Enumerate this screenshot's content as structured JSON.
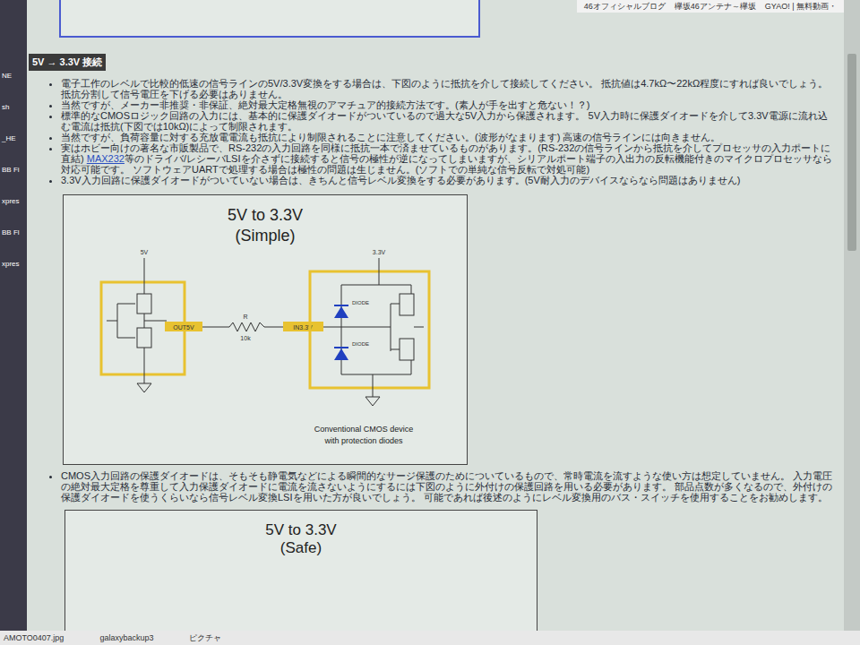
{
  "browser_tabs": [
    "46オフィシャルブログ",
    "欅坂46アンテナ～欅坂",
    "GYAO! | 無料動画・"
  ],
  "desktop_icons": [
    "NE",
    "sh",
    "_HE",
    "BB Fi",
    "xpres",
    "BB Fl",
    "xpres"
  ],
  "section_heading": "5V → 3.3V 接続",
  "bullets": [
    [
      {
        "text": "電子工作のレベルで比較的低速の信号ラインの5V/3.3V変換をする場合は、下図のように抵抗を介して接続してください。 抵抗値は4.7kΩ〜22kΩ程度にすれば良いでしょう。 抵抗分割して信号電圧を下げる必要はありません。",
        "link": false
      }
    ],
    [
      {
        "text": "当然ですが、メーカー非推奨・非保証、絶対最大定格無視のアマチュア的接続方法です。(素人が手を出すと危ない！？)",
        "link": false
      }
    ],
    [
      {
        "text": "標準的なCMOSロジック回路の入力には、基本的に保護ダイオードがついているので過大な5V入力から保護されます。 5V入力時に保護ダイオードを介して3.3V電源に流れ込む電流は抵抗(下図では10kΩ)によって制限されます。",
        "link": false
      }
    ],
    [
      {
        "text": "当然ですが、負荷容量に対する充放電電流も抵抗により制限されることに注意してください。(波形がなまります) 高速の信号ラインには向きません。",
        "link": false
      }
    ],
    [
      {
        "text": "実はホビー向けの著名な市販製品で、RS-232の入力回路を同様に抵抗一本で済ませているものがあります。(RS-232の信号ラインから抵抗を介してプロセッサの入力ポートに直結) ",
        "link": false
      },
      {
        "text": "MAX232",
        "link": true
      },
      {
        "text": "等のドライバ/レシーバLSIを介さずに接続すると信号の極性が逆になってしまいますが、シリアルポート端子の入出力の反転機能付きのマイクロプロセッサなら対応可能です。 ソフトウェアUARTで処理する場合は極性の問題は生じません。(ソフトでの単純な信号反転で対処可能)",
        "link": false
      }
    ],
    [
      {
        "text": "3.3V入力回路に保護ダイオードがついていない場合は、きちんと信号レベル変換をする必要があります。(5V耐入力のデバイスならなら問題はありません)",
        "link": false
      }
    ]
  ],
  "figure1": {
    "title": "5V to 3.3V",
    "subtitle": "(Simple)",
    "vdd_left": "5V",
    "out_label": "OUT5V",
    "resistor": "R",
    "resistor_value": "10k",
    "in_label": "IN3.3V",
    "vdd_right": "3.3V",
    "diodes": [
      "DIODE",
      "DIODE"
    ],
    "caption": [
      "Conventional CMOS device",
      "with protection diodes"
    ]
  },
  "bullets_after": [
    [
      {
        "text": "CMOS入力回路の保護ダイオードは、そもそも静電気などによる瞬間的なサージ保護のためについているもので、常時電流を流すような使い方は想定していません。 入力電圧の絶対最大定格を尊重して入力保護ダイオードに電流を流さないようにするには下図のように外付けの保護回路を用いる必要があります。 部品点数が多くなるので、外付けの保護ダイオードを使うくらいなら信号レベル変換LSIを用いた方が良いでしょう。 可能であれば後述のようにレベル変換用のバス・スイッチを使用することをお勧めします。",
        "link": false
      }
    ]
  ],
  "figure2": {
    "title": "5V to 3.3V",
    "subtitle": "(Safe)"
  },
  "taskbar": [
    "AMOTO0407.jpg",
    "galaxybackup3",
    "ピクチャ"
  ]
}
